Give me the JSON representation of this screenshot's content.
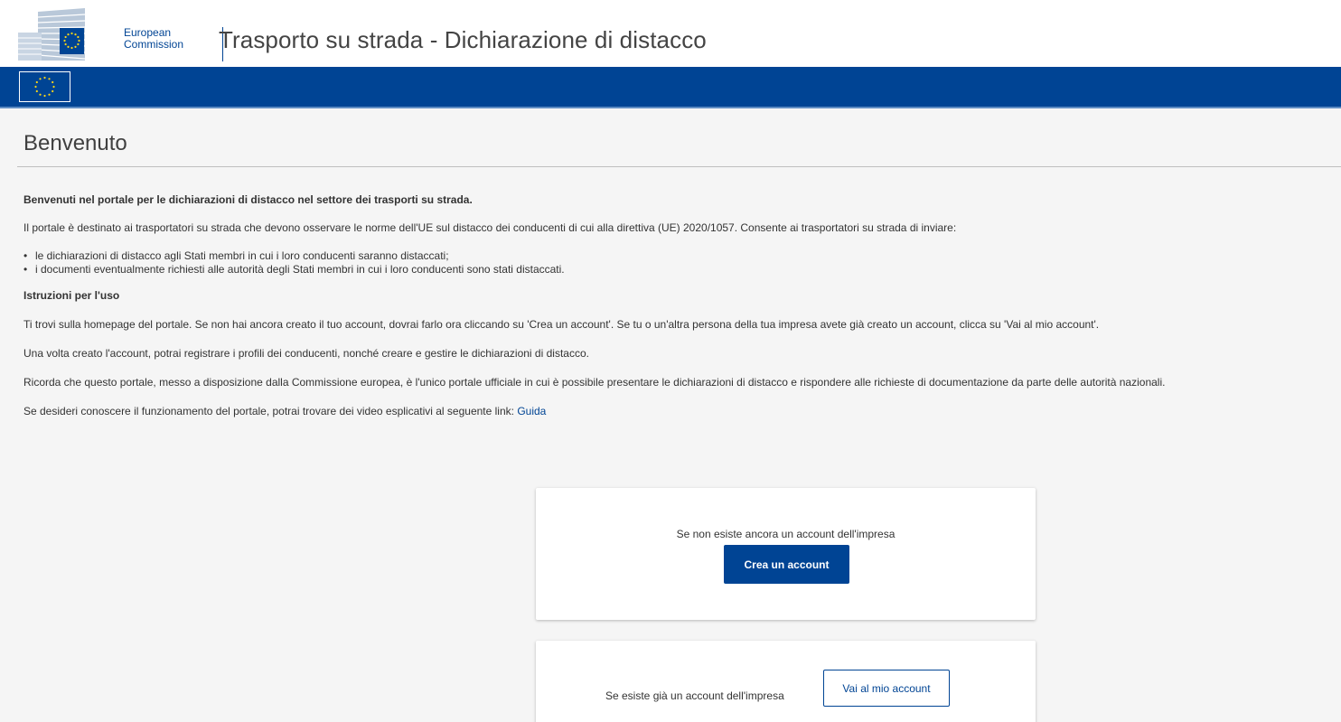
{
  "header": {
    "logo_line1": "European",
    "logo_line2": "Commission",
    "site_title": "Trasporto su strada - Dichiarazione di distacco"
  },
  "main": {
    "page_title": "Benvenuto",
    "intro_heading": "Benvenuti nel portale per le dichiarazioni di distacco nel settore dei trasporti su strada.",
    "intro_paragraph": "Il portale è destinato ai trasportatori su strada che devono osservare le norme dell'UE sul distacco dei conducenti di cui alla direttiva (UE) 2020/1057. Consente ai trasportatori su strada di inviare:",
    "list_items": [
      "le dichiarazioni di distacco agli Stati membri in cui i loro conducenti saranno distaccati;",
      "i documenti eventualmente richiesti alle autorità degli Stati membri in cui i loro conducenti sono stati distaccati."
    ],
    "instructions_heading": "Istruzioni per l'uso",
    "para_homepage": "Ti trovi sulla homepage del portale. Se non hai ancora creato il tuo account, dovrai farlo ora cliccando su 'Crea un account'. Se tu o un'altra persona della tua impresa avete già creato un account, clicca su 'Vai al mio account'.",
    "para_profiles": "Una volta creato l'account, potrai registrare i profili dei conducenti, nonché creare e gestire le dichiarazioni di distacco.",
    "para_official": "Ricorda che questo portale, messo a disposizione dalla Commissione europea, è l'unico portale ufficiale in cui è possibile presentare le dichiarazioni di distacco e rispondere alle richieste di documentazione da parte delle autorità nazionali.",
    "para_video": "Se desideri conoscere il funzionamento del portale, potrai trovare dei video esplicativi al seguente link: ",
    "guide_link": "Guida"
  },
  "card_create": {
    "text": "Se non esiste ancora un account dell'impresa",
    "button": "Crea un account"
  },
  "card_existing": {
    "text": "Se esiste già un account dell'impresa",
    "button": "Vai al mio account"
  },
  "colors": {
    "brand_blue": "#004494",
    "eu_yellow": "#ffd617",
    "background": "#f5f5f5"
  }
}
